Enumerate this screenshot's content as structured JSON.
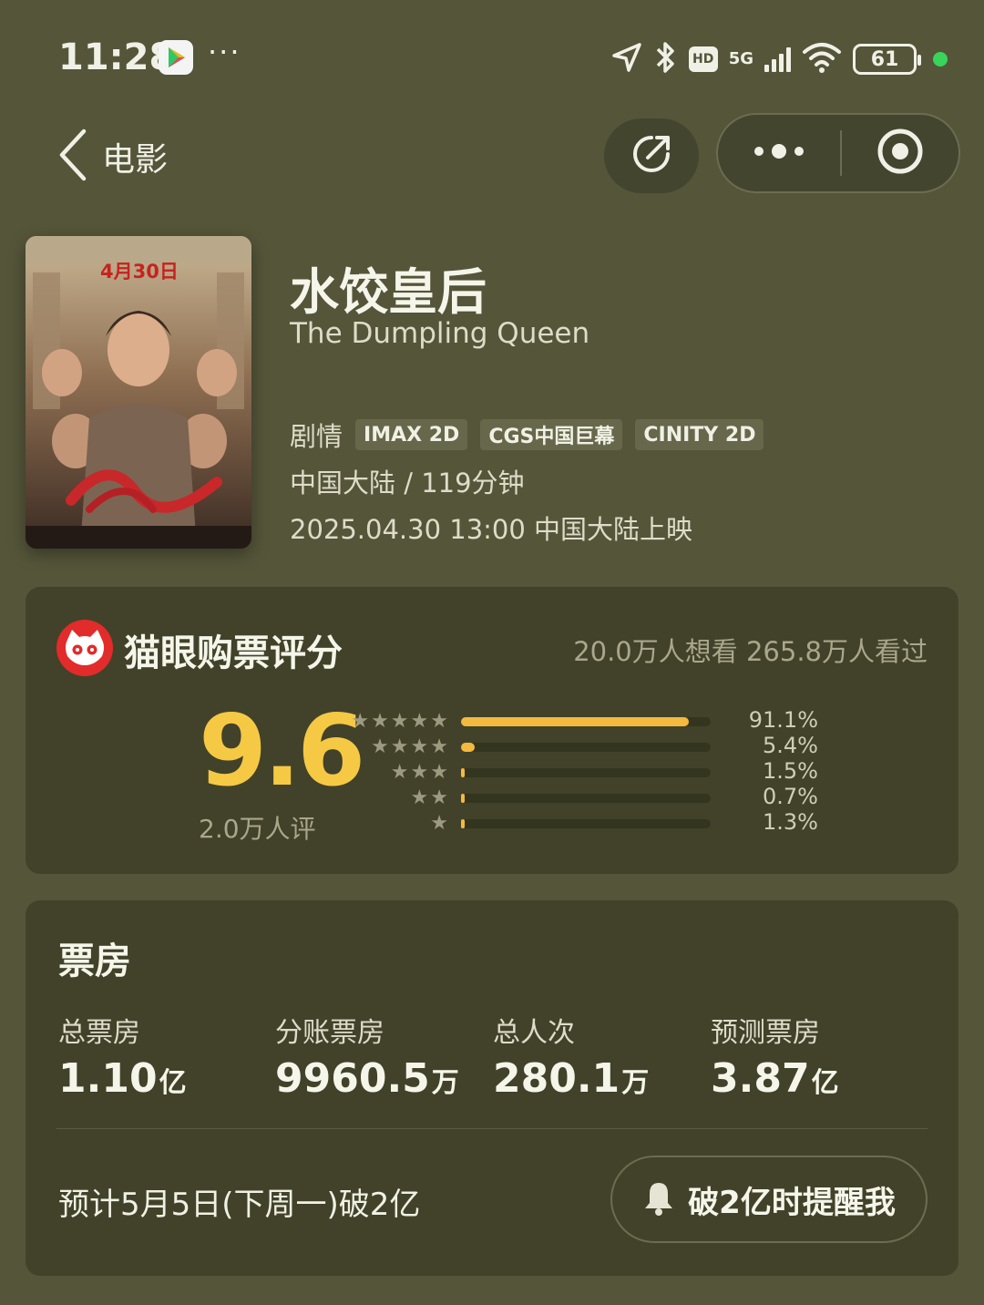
{
  "status_bar": {
    "time": "11:28",
    "network": "5G",
    "hd": "HD",
    "battery": "61",
    "icons": [
      "location-icon",
      "bluetooth-icon",
      "hd-icon",
      "signal-icon",
      "wifi-icon",
      "battery-icon"
    ]
  },
  "nav": {
    "back_label": "电影"
  },
  "movie": {
    "title": "水饺皇后",
    "title_en": "The Dumpling Queen",
    "genre": "剧情",
    "tags": [
      "IMAX 2D",
      "CGS中国巨幕",
      "CINITY 2D"
    ],
    "region_duration": "中国大陆 / 119分钟",
    "release": "2025.04.30 13:00 中国大陆上映",
    "poster_date": "4月30日"
  },
  "rating": {
    "title": "猫眼购票评分",
    "counts": "20.0万人想看 265.8万人看过",
    "score": "9.6",
    "score_count": "2.0万人评",
    "distribution": [
      {
        "stars": 5,
        "percent": 91.1,
        "label": "91.1%"
      },
      {
        "stars": 4,
        "percent": 5.4,
        "label": "5.4%"
      },
      {
        "stars": 3,
        "percent": 1.5,
        "label": "1.5%"
      },
      {
        "stars": 2,
        "percent": 0.7,
        "label": "0.7%"
      },
      {
        "stars": 1,
        "percent": 1.3,
        "label": "1.3%"
      }
    ]
  },
  "box_office": {
    "title": "票房",
    "stats": [
      {
        "label": "总票房",
        "value": "1.10",
        "unit": "亿"
      },
      {
        "label": "分账票房",
        "value": "9960.5",
        "unit": "万"
      },
      {
        "label": "总人次",
        "value": "280.1",
        "unit": "万"
      },
      {
        "label": "预测票房",
        "value": "3.87",
        "unit": "亿"
      }
    ],
    "forecast": "预计5月5日(下周一)破2亿",
    "remind_label": "破2亿时提醒我"
  },
  "colors": {
    "background": "#545539",
    "card": "#414229",
    "accent_score": "#f6c945",
    "bar_fill": "#f4b93f",
    "maoyan_red": "#e22b2b"
  }
}
